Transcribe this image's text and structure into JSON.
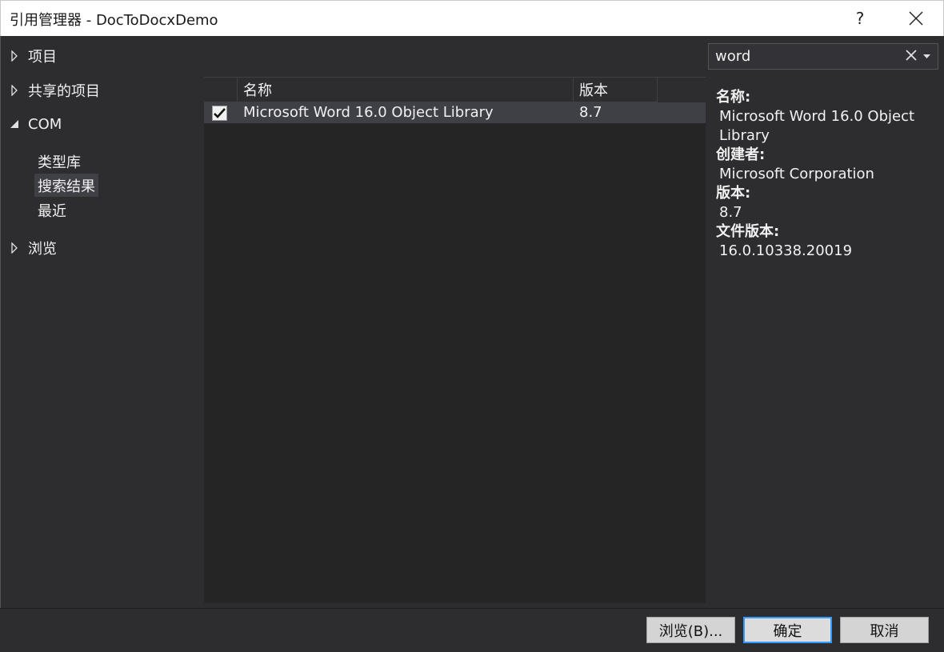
{
  "window": {
    "title": "引用管理器 - DocToDocxDemo",
    "help_label": "?"
  },
  "nav": {
    "items": [
      {
        "label": "项目",
        "expanded": false
      },
      {
        "label": "共享的项目",
        "expanded": false
      },
      {
        "label": "COM",
        "expanded": true
      },
      {
        "label": "浏览",
        "expanded": false
      }
    ],
    "com_children": [
      {
        "label": "类型库"
      },
      {
        "label": "搜索结果",
        "selected": true
      },
      {
        "label": "最近"
      }
    ]
  },
  "list": {
    "columns": [
      "名称",
      "版本"
    ],
    "rows": [
      {
        "checked": true,
        "name": "Microsoft Word 16.0 Object Library",
        "version": "8.7"
      }
    ]
  },
  "search": {
    "value": "word"
  },
  "details": {
    "name_label": "名称:",
    "name_value": "Microsoft Word 16.0 Object Library",
    "author_label": "创建者:",
    "author_value": "Microsoft Corporation",
    "version_label": "版本:",
    "version_value": "8.7",
    "file_version_label": "文件版本:",
    "file_version_value": "16.0.10338.20019"
  },
  "footer": {
    "browse_label": "浏览(B)...",
    "ok_label": "确定",
    "cancel_label": "取消"
  },
  "colors": {
    "background": "#2d2d30",
    "list_background": "#252526",
    "selected_row": "#3f3f46",
    "accent": "#3399ff"
  }
}
